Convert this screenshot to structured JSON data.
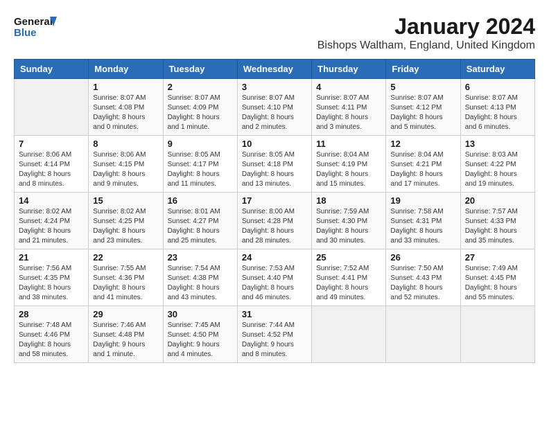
{
  "logo": {
    "line1": "General",
    "line2": "Blue"
  },
  "title": "January 2024",
  "subtitle": "Bishops Waltham, England, United Kingdom",
  "colors": {
    "header_bg": "#2a6cb5",
    "header_text": "#ffffff"
  },
  "weekdays": [
    "Sunday",
    "Monday",
    "Tuesday",
    "Wednesday",
    "Thursday",
    "Friday",
    "Saturday"
  ],
  "weeks": [
    [
      {
        "day": "",
        "sunrise": "",
        "sunset": "",
        "daylight": ""
      },
      {
        "day": "1",
        "sunrise": "Sunrise: 8:07 AM",
        "sunset": "Sunset: 4:08 PM",
        "daylight": "Daylight: 8 hours and 0 minutes."
      },
      {
        "day": "2",
        "sunrise": "Sunrise: 8:07 AM",
        "sunset": "Sunset: 4:09 PM",
        "daylight": "Daylight: 8 hours and 1 minute."
      },
      {
        "day": "3",
        "sunrise": "Sunrise: 8:07 AM",
        "sunset": "Sunset: 4:10 PM",
        "daylight": "Daylight: 8 hours and 2 minutes."
      },
      {
        "day": "4",
        "sunrise": "Sunrise: 8:07 AM",
        "sunset": "Sunset: 4:11 PM",
        "daylight": "Daylight: 8 hours and 3 minutes."
      },
      {
        "day": "5",
        "sunrise": "Sunrise: 8:07 AM",
        "sunset": "Sunset: 4:12 PM",
        "daylight": "Daylight: 8 hours and 5 minutes."
      },
      {
        "day": "6",
        "sunrise": "Sunrise: 8:07 AM",
        "sunset": "Sunset: 4:13 PM",
        "daylight": "Daylight: 8 hours and 6 minutes."
      }
    ],
    [
      {
        "day": "7",
        "sunrise": "Sunrise: 8:06 AM",
        "sunset": "Sunset: 4:14 PM",
        "daylight": "Daylight: 8 hours and 8 minutes."
      },
      {
        "day": "8",
        "sunrise": "Sunrise: 8:06 AM",
        "sunset": "Sunset: 4:15 PM",
        "daylight": "Daylight: 8 hours and 9 minutes."
      },
      {
        "day": "9",
        "sunrise": "Sunrise: 8:05 AM",
        "sunset": "Sunset: 4:17 PM",
        "daylight": "Daylight: 8 hours and 11 minutes."
      },
      {
        "day": "10",
        "sunrise": "Sunrise: 8:05 AM",
        "sunset": "Sunset: 4:18 PM",
        "daylight": "Daylight: 8 hours and 13 minutes."
      },
      {
        "day": "11",
        "sunrise": "Sunrise: 8:04 AM",
        "sunset": "Sunset: 4:19 PM",
        "daylight": "Daylight: 8 hours and 15 minutes."
      },
      {
        "day": "12",
        "sunrise": "Sunrise: 8:04 AM",
        "sunset": "Sunset: 4:21 PM",
        "daylight": "Daylight: 8 hours and 17 minutes."
      },
      {
        "day": "13",
        "sunrise": "Sunrise: 8:03 AM",
        "sunset": "Sunset: 4:22 PM",
        "daylight": "Daylight: 8 hours and 19 minutes."
      }
    ],
    [
      {
        "day": "14",
        "sunrise": "Sunrise: 8:02 AM",
        "sunset": "Sunset: 4:24 PM",
        "daylight": "Daylight: 8 hours and 21 minutes."
      },
      {
        "day": "15",
        "sunrise": "Sunrise: 8:02 AM",
        "sunset": "Sunset: 4:25 PM",
        "daylight": "Daylight: 8 hours and 23 minutes."
      },
      {
        "day": "16",
        "sunrise": "Sunrise: 8:01 AM",
        "sunset": "Sunset: 4:27 PM",
        "daylight": "Daylight: 8 hours and 25 minutes."
      },
      {
        "day": "17",
        "sunrise": "Sunrise: 8:00 AM",
        "sunset": "Sunset: 4:28 PM",
        "daylight": "Daylight: 8 hours and 28 minutes."
      },
      {
        "day": "18",
        "sunrise": "Sunrise: 7:59 AM",
        "sunset": "Sunset: 4:30 PM",
        "daylight": "Daylight: 8 hours and 30 minutes."
      },
      {
        "day": "19",
        "sunrise": "Sunrise: 7:58 AM",
        "sunset": "Sunset: 4:31 PM",
        "daylight": "Daylight: 8 hours and 33 minutes."
      },
      {
        "day": "20",
        "sunrise": "Sunrise: 7:57 AM",
        "sunset": "Sunset: 4:33 PM",
        "daylight": "Daylight: 8 hours and 35 minutes."
      }
    ],
    [
      {
        "day": "21",
        "sunrise": "Sunrise: 7:56 AM",
        "sunset": "Sunset: 4:35 PM",
        "daylight": "Daylight: 8 hours and 38 minutes."
      },
      {
        "day": "22",
        "sunrise": "Sunrise: 7:55 AM",
        "sunset": "Sunset: 4:36 PM",
        "daylight": "Daylight: 8 hours and 41 minutes."
      },
      {
        "day": "23",
        "sunrise": "Sunrise: 7:54 AM",
        "sunset": "Sunset: 4:38 PM",
        "daylight": "Daylight: 8 hours and 43 minutes."
      },
      {
        "day": "24",
        "sunrise": "Sunrise: 7:53 AM",
        "sunset": "Sunset: 4:40 PM",
        "daylight": "Daylight: 8 hours and 46 minutes."
      },
      {
        "day": "25",
        "sunrise": "Sunrise: 7:52 AM",
        "sunset": "Sunset: 4:41 PM",
        "daylight": "Daylight: 8 hours and 49 minutes."
      },
      {
        "day": "26",
        "sunrise": "Sunrise: 7:50 AM",
        "sunset": "Sunset: 4:43 PM",
        "daylight": "Daylight: 8 hours and 52 minutes."
      },
      {
        "day": "27",
        "sunrise": "Sunrise: 7:49 AM",
        "sunset": "Sunset: 4:45 PM",
        "daylight": "Daylight: 8 hours and 55 minutes."
      }
    ],
    [
      {
        "day": "28",
        "sunrise": "Sunrise: 7:48 AM",
        "sunset": "Sunset: 4:46 PM",
        "daylight": "Daylight: 8 hours and 58 minutes."
      },
      {
        "day": "29",
        "sunrise": "Sunrise: 7:46 AM",
        "sunset": "Sunset: 4:48 PM",
        "daylight": "Daylight: 9 hours and 1 minute."
      },
      {
        "day": "30",
        "sunrise": "Sunrise: 7:45 AM",
        "sunset": "Sunset: 4:50 PM",
        "daylight": "Daylight: 9 hours and 4 minutes."
      },
      {
        "day": "31",
        "sunrise": "Sunrise: 7:44 AM",
        "sunset": "Sunset: 4:52 PM",
        "daylight": "Daylight: 9 hours and 8 minutes."
      },
      {
        "day": "",
        "sunrise": "",
        "sunset": "",
        "daylight": ""
      },
      {
        "day": "",
        "sunrise": "",
        "sunset": "",
        "daylight": ""
      },
      {
        "day": "",
        "sunrise": "",
        "sunset": "",
        "daylight": ""
      }
    ]
  ]
}
